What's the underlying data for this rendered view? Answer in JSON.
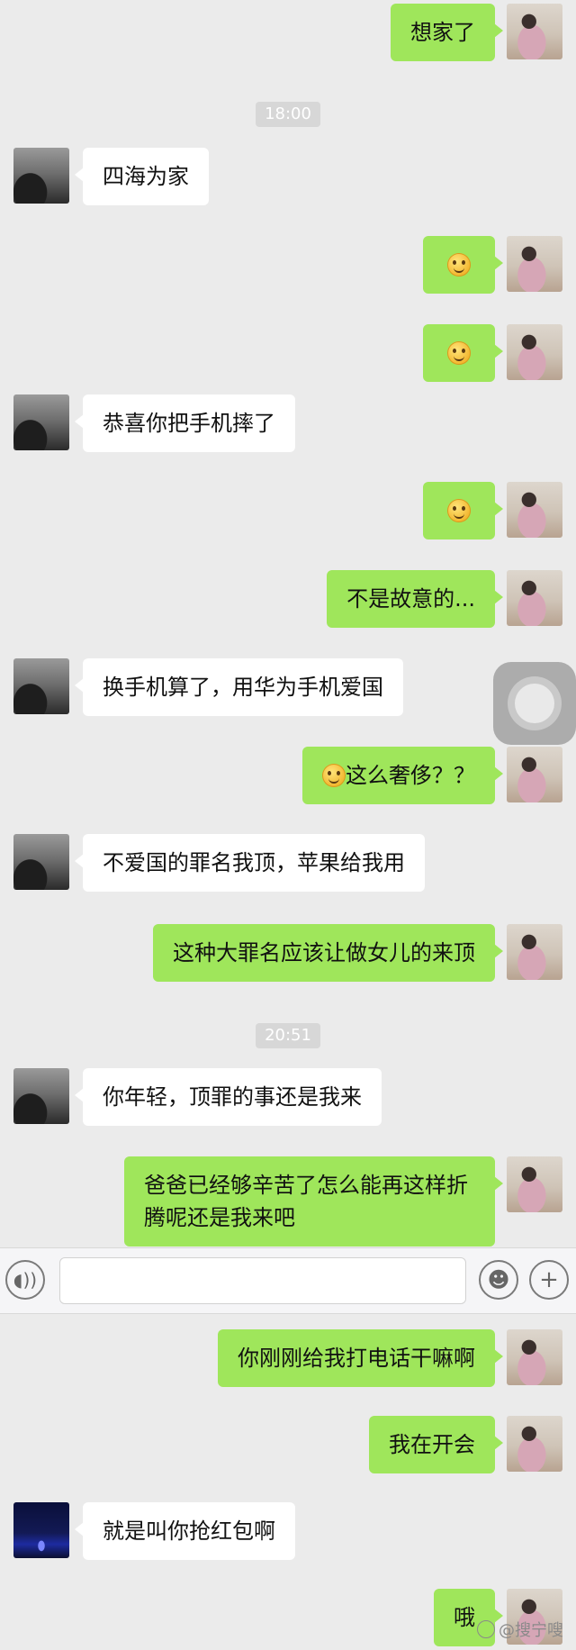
{
  "messages": [
    {
      "text": "想家了"
    },
    {
      "time": "18:00"
    },
    {
      "text": "四海为家"
    },
    {
      "text": ""
    },
    {
      "text": ""
    },
    {
      "text": "恭喜你把手机摔了"
    },
    {
      "text": ""
    },
    {
      "text": "不是故意的..."
    },
    {
      "text": "换手机算了，用华为手机爱国"
    },
    {
      "text": "这么奢侈？？"
    },
    {
      "text": "不爱国的罪名我顶，苹果给我用"
    },
    {
      "text": "这种大罪名应该让做女儿的来顶"
    },
    {
      "time": "20:51"
    },
    {
      "text": "你年轻，顶罪的事还是我来"
    },
    {
      "text": "爸爸已经够辛苦了怎么能再这样折腾呢还是我来吧"
    },
    {
      "text": "你刚刚给我打电话干嘛啊"
    },
    {
      "text": "我在开会"
    },
    {
      "text": "就是叫你抢红包啊"
    },
    {
      "text": "哦"
    }
  ],
  "input_bar": {
    "plus_label": "+"
  },
  "watermark": {
    "text": "@搜宁嗖"
  },
  "colors": {
    "me_bubble": "#9fe65b",
    "other_bubble": "#ffffff",
    "background": "#ebebeb"
  },
  "icons": {
    "voice": "voice-wave-icon",
    "emoji": "smiley-icon",
    "plus": "plus-icon"
  }
}
